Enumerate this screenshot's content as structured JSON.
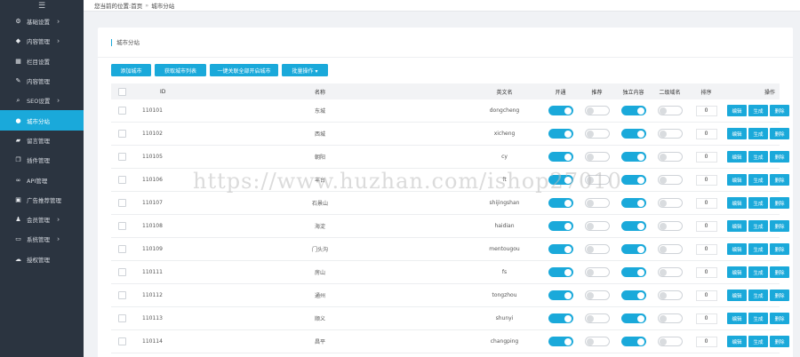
{
  "sidebar": {
    "toggle_icon": "menu-icon",
    "items": [
      {
        "label": "基础设置",
        "icon": "gear-icon",
        "has_arrow": true,
        "active": false
      },
      {
        "label": "内容管理",
        "icon": "tag-icon",
        "has_arrow": true,
        "active": false
      },
      {
        "label": "栏目设置",
        "icon": "grid-icon",
        "has_arrow": false,
        "active": false
      },
      {
        "label": "内容管理",
        "icon": "edit-icon",
        "has_arrow": false,
        "active": false
      },
      {
        "label": "SEO设置",
        "icon": "search-icon",
        "has_arrow": true,
        "active": false
      },
      {
        "label": "城市分站",
        "icon": "globe-icon",
        "has_arrow": false,
        "active": true
      },
      {
        "label": "留言管理",
        "icon": "chat-icon",
        "has_arrow": false,
        "active": false
      },
      {
        "label": "插件管理",
        "icon": "copy-icon",
        "has_arrow": false,
        "active": false
      },
      {
        "label": "API管理",
        "icon": "link-icon",
        "has_arrow": false,
        "active": false
      },
      {
        "label": "广告推荐管理",
        "icon": "image-icon",
        "has_arrow": false,
        "active": false
      },
      {
        "label": "会员管理",
        "icon": "user-icon",
        "has_arrow": true,
        "active": false
      },
      {
        "label": "系统管理",
        "icon": "monitor-icon",
        "has_arrow": true,
        "active": false
      },
      {
        "label": "授权管理",
        "icon": "cloud-icon",
        "has_arrow": false,
        "active": false
      }
    ]
  },
  "breadcrumb": {
    "prefix": "您当前的位置:",
    "home": "首页",
    "separator": "»",
    "current": "城市分站"
  },
  "panel": {
    "title": "城市分站"
  },
  "toolbar": {
    "add_label": "添加城市",
    "get_label": "获取城市列表",
    "bulk_label": "一键关联全部开启城市",
    "batch_label": "批量操作 ▾"
  },
  "table": {
    "headers": [
      "ID",
      "名称",
      "英文名",
      "开通",
      "推荐",
      "独立内容",
      "二级域名",
      "排序",
      "操作"
    ],
    "ops": {
      "edit": "编辑",
      "gen": "生成",
      "del": "删除"
    },
    "rows": [
      {
        "id": "110101",
        "name": "东城",
        "pinyin": "dongcheng",
        "open": true,
        "rec": false,
        "indep": true,
        "sub": false,
        "sort": "0"
      },
      {
        "id": "110102",
        "name": "西城",
        "pinyin": "xicheng",
        "open": true,
        "rec": false,
        "indep": true,
        "sub": false,
        "sort": "0"
      },
      {
        "id": "110105",
        "name": "朝阳",
        "pinyin": "cy",
        "open": true,
        "rec": false,
        "indep": true,
        "sub": false,
        "sort": "0"
      },
      {
        "id": "110106",
        "name": "丰台",
        "pinyin": "ft",
        "open": true,
        "rec": false,
        "indep": true,
        "sub": false,
        "sort": "0"
      },
      {
        "id": "110107",
        "name": "石景山",
        "pinyin": "shijingshan",
        "open": true,
        "rec": false,
        "indep": true,
        "sub": false,
        "sort": "0"
      },
      {
        "id": "110108",
        "name": "海淀",
        "pinyin": "haidian",
        "open": true,
        "rec": false,
        "indep": true,
        "sub": false,
        "sort": "0"
      },
      {
        "id": "110109",
        "name": "门头沟",
        "pinyin": "mentougou",
        "open": true,
        "rec": false,
        "indep": true,
        "sub": false,
        "sort": "0"
      },
      {
        "id": "110111",
        "name": "房山",
        "pinyin": "fs",
        "open": true,
        "rec": false,
        "indep": true,
        "sub": false,
        "sort": "0"
      },
      {
        "id": "110112",
        "name": "通州",
        "pinyin": "tongzhou",
        "open": true,
        "rec": false,
        "indep": true,
        "sub": false,
        "sort": "0"
      },
      {
        "id": "110113",
        "name": "顺义",
        "pinyin": "shunyi",
        "open": true,
        "rec": false,
        "indep": true,
        "sub": false,
        "sort": "0"
      },
      {
        "id": "110114",
        "name": "昌平",
        "pinyin": "changping",
        "open": true,
        "rec": false,
        "indep": true,
        "sub": false,
        "sort": "0"
      }
    ]
  },
  "watermark": "https://www.huzhan.com/ishop27010",
  "colors": {
    "accent": "#1aa9da",
    "sidebar": "#2b3440"
  }
}
